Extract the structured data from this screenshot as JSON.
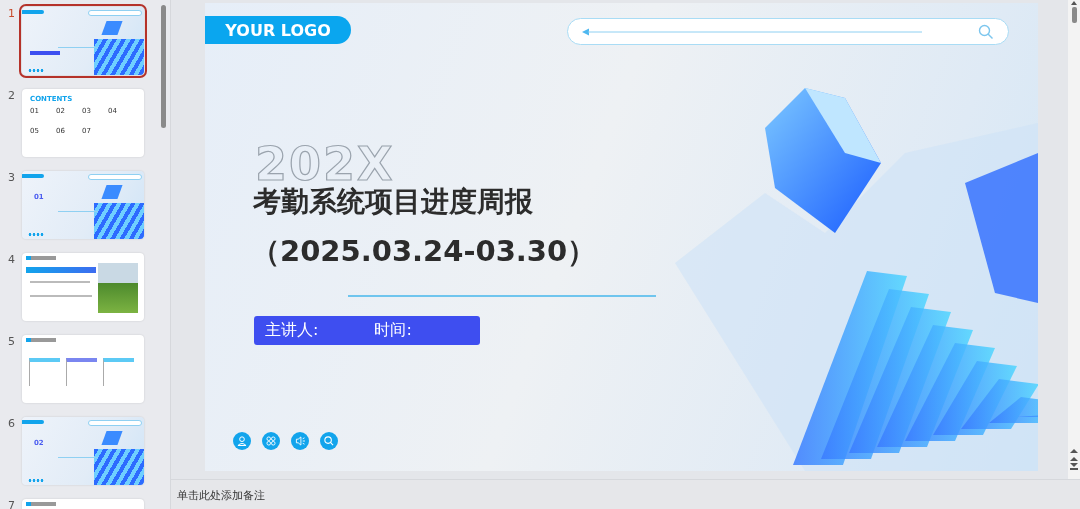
{
  "thumbnails": [
    {
      "number": "1",
      "kind": "title",
      "selected": true
    },
    {
      "number": "2",
      "kind": "contents",
      "selected": false,
      "heading": "CONTENTS",
      "items": [
        "01",
        "02",
        "03",
        "04",
        "05",
        "06",
        "07"
      ]
    },
    {
      "number": "3",
      "kind": "section",
      "selected": false,
      "index": "01"
    },
    {
      "number": "4",
      "kind": "content",
      "selected": false
    },
    {
      "number": "5",
      "kind": "columns",
      "selected": false
    },
    {
      "number": "6",
      "kind": "section",
      "selected": false,
      "index": "02"
    },
    {
      "number": "7",
      "kind": "content",
      "selected": false
    }
  ],
  "slide": {
    "logo": "YOUR LOGO",
    "year": "202X",
    "title": "考勤系统项目进度周报",
    "date": "（2025.03.24-03.30）",
    "presenter_label": "主讲人:",
    "time_label": "时间:"
  },
  "notes": {
    "placeholder": "单击此处添加备注"
  }
}
